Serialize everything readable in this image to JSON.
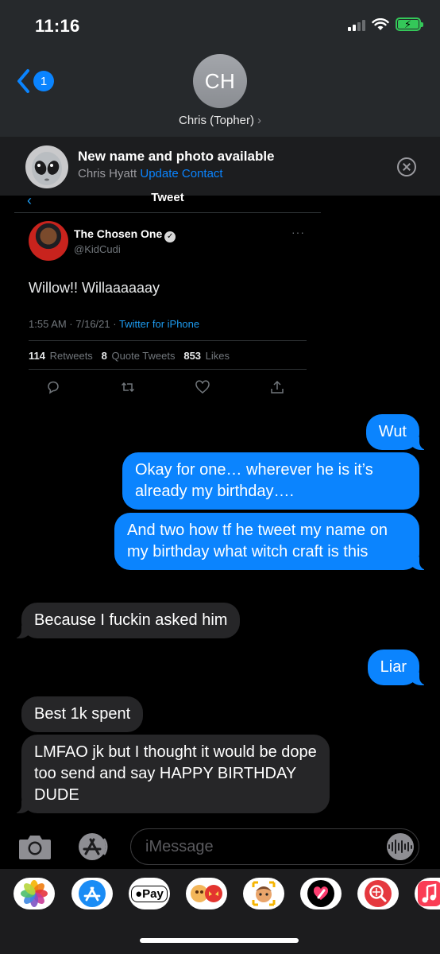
{
  "status_bar": {
    "time": "11:16"
  },
  "header": {
    "back_count": "1",
    "avatar_initials": "CH",
    "contact_name": "Chris (Topher)",
    "contact_chevron": "›"
  },
  "banner": {
    "title": "New name and photo available",
    "name": "Chris Hyatt",
    "action": "Update Contact"
  },
  "tweet": {
    "header": "Tweet",
    "author_name": "The Chosen One",
    "author_handle": "@KidCudi",
    "more": "···",
    "text": "Willow!!  Willaaaaaay",
    "time_date": "1:55 AM · 7/16/21 · ",
    "source": "Twitter for iPhone",
    "retweets_count": "114",
    "retweets_label": "Retweets",
    "quote_count": "8",
    "quote_label": "Quote Tweets",
    "likes_count": "853",
    "likes_label": "Likes"
  },
  "messages": [
    {
      "from": "me",
      "text": "Wut"
    },
    {
      "from": "me",
      "text": "Okay for one… wherever he is it’s already my birthday…."
    },
    {
      "from": "me",
      "text": "And two how tf he tweet my name on my birthday what witch craft is this"
    },
    {
      "from": "them",
      "text": "Because I fuckin asked him"
    },
    {
      "from": "me",
      "text": "Liar"
    },
    {
      "from": "them",
      "text": "Best 1k spent"
    },
    {
      "from": "them",
      "text": "LMFAO jk but I thought it would be dope too send and say HAPPY BIRTHDAY DUDE"
    }
  ],
  "input": {
    "placeholder": "iMessage"
  },
  "drawer": {
    "apps": [
      "photos-app-icon",
      "app-store-app-icon",
      "apple-pay-app-icon",
      "memoji-stickers-app-icon",
      "animoji-app-icon",
      "digital-touch-app-icon",
      "web-search-app-icon",
      "music-app-icon"
    ],
    "apple_pay_label": "Pay"
  },
  "colors": {
    "sent_bubble": "#0b84fe",
    "received_bubble": "#262628",
    "accent": "#0a84ff",
    "twitter_blue": "#1d9bf0"
  }
}
